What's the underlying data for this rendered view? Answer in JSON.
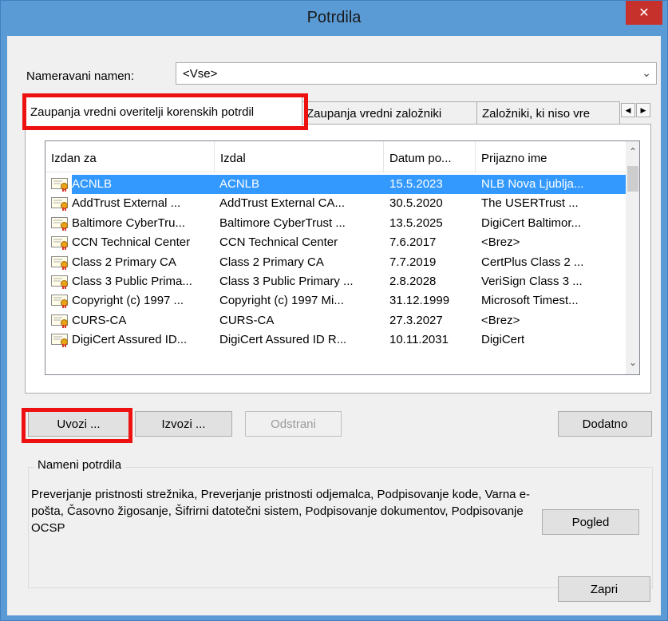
{
  "window": {
    "title": "Potrdila",
    "close_glyph": "✕"
  },
  "purpose": {
    "label": "Nameravani namen:",
    "value": "<Vse>",
    "arrow": "⌄"
  },
  "tabs": [
    {
      "label": "Zaupanja vredni overitelji korenskih potrdil"
    },
    {
      "label": "Zaupanja vredni založniki"
    },
    {
      "label": "Založniki, ki niso vre"
    }
  ],
  "tab_scroll": {
    "left": "◀",
    "right": "▶"
  },
  "list": {
    "columns": [
      "Izdan za",
      "Izdal",
      "Datum po...",
      "Prijazno ime"
    ],
    "rows": [
      {
        "issued_to": "ACNLB",
        "issued_by": "ACNLB",
        "expiry": "15.5.2023",
        "friendly": "NLB Nova Ljublja..."
      },
      {
        "issued_to": "AddTrust External ...",
        "issued_by": "AddTrust External CA...",
        "expiry": "30.5.2020",
        "friendly": "The USERTrust ..."
      },
      {
        "issued_to": "Baltimore CyberTru...",
        "issued_by": "Baltimore CyberTrust ...",
        "expiry": "13.5.2025",
        "friendly": "DigiCert Baltimor..."
      },
      {
        "issued_to": "CCN Technical Center",
        "issued_by": "CCN Technical Center",
        "expiry": "7.6.2017",
        "friendly": "<Brez>"
      },
      {
        "issued_to": "Class 2 Primary CA",
        "issued_by": "Class 2 Primary CA",
        "expiry": "7.7.2019",
        "friendly": "CertPlus Class 2 ..."
      },
      {
        "issued_to": "Class 3 Public Prima...",
        "issued_by": "Class 3 Public Primary ...",
        "expiry": "2.8.2028",
        "friendly": "VeriSign Class 3 ..."
      },
      {
        "issued_to": "Copyright (c) 1997 ...",
        "issued_by": "Copyright (c) 1997 Mi...",
        "expiry": "31.12.1999",
        "friendly": "Microsoft Timest..."
      },
      {
        "issued_to": "CURS-CA",
        "issued_by": "CURS-CA",
        "expiry": "27.3.2027",
        "friendly": "<Brez>"
      },
      {
        "issued_to": "DigiCert Assured ID...",
        "issued_by": "DigiCert Assured ID R...",
        "expiry": "10.11.2031",
        "friendly": "DigiCert"
      }
    ],
    "selected_index": 0,
    "scroll_up": "⌃",
    "scroll_down": "⌄"
  },
  "buttons": {
    "import": "Uvozi ...",
    "export": "Izvozi ...",
    "remove": "Odstrani",
    "advanced": "Dodatno",
    "view": "Pogled",
    "close": "Zapri"
  },
  "purposes_group": {
    "legend": "Nameni potrdila",
    "text": "Preverjanje pristnosti strežnika, Preverjanje pristnosti odjemalca, Podpisovanje kode, Varna e-pošta, Časovno žigosanje, Šifrirni datotečni sistem, Podpisovanje dokumentov, Podpisovanje OCSP"
  },
  "colors": {
    "titlebar": "#5b9bd5",
    "close_button": "#c7312b",
    "selection": "#3399ff",
    "highlight_box": "#ee1111",
    "dialog_bg": "#f0f0f0"
  },
  "icons": {
    "certificate": "certificate-icon"
  }
}
